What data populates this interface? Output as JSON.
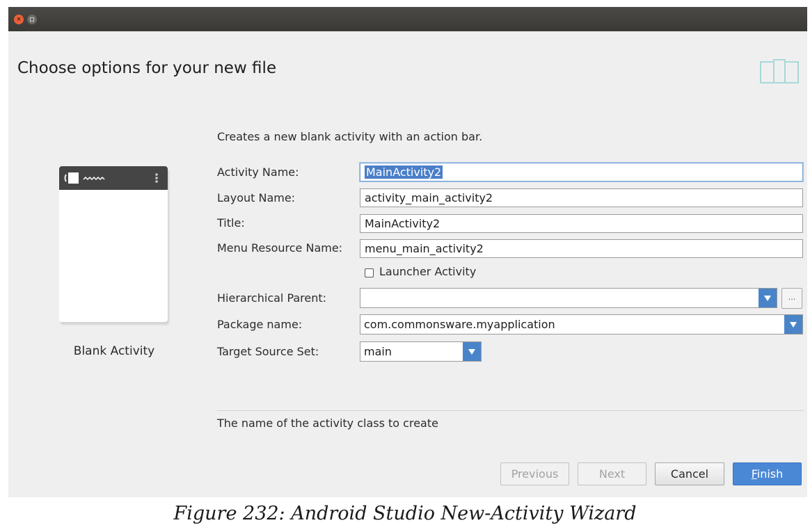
{
  "dialog": {
    "title": "Choose options for your new file",
    "description": "Creates a new blank activity with an action bar."
  },
  "template": {
    "label": "Blank Activity"
  },
  "form": {
    "activity_name": {
      "label": "Activity Name:",
      "value": "MainActivity2"
    },
    "layout_name": {
      "label": "Layout Name:",
      "value": "activity_main_activity2"
    },
    "title": {
      "label": "Title:",
      "value": "MainActivity2"
    },
    "menu_resource_name": {
      "label": "Menu Resource Name:",
      "value": "menu_main_activity2"
    },
    "launcher_activity": {
      "label": "Launcher Activity",
      "checked": false
    },
    "hierarchical_parent": {
      "label": "Hierarchical Parent:",
      "value": "",
      "browse_label": "..."
    },
    "package_name": {
      "label": "Package name:",
      "value": "com.commonsware.myapplication"
    },
    "target_source_set": {
      "label": "Target Source Set:",
      "value": "main"
    }
  },
  "hint": "The name of the activity class to create",
  "buttons": {
    "previous": "Previous",
    "next": "Next",
    "cancel": "Cancel",
    "finish_first": "F",
    "finish_rest": "inish"
  },
  "caption": "Figure 232: Android Studio New-Activity Wizard",
  "colors": {
    "accent": "#4a84c8",
    "titlebar": "#3e3d39",
    "dialog_bg": "#efefef"
  }
}
